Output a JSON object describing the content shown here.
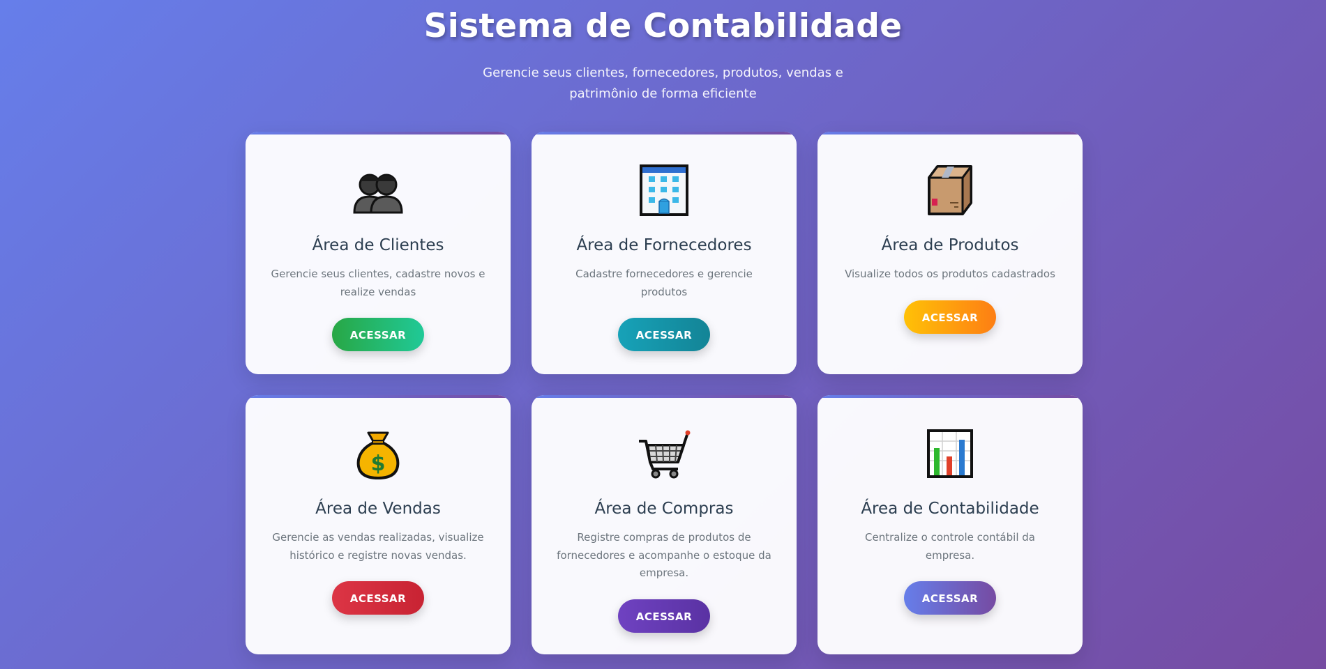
{
  "header": {
    "title": "Sistema de Contabilidade",
    "subtitle": "Gerencie seus clientes, fornecedores, produtos, vendas e patrimônio de forma eficiente"
  },
  "cards": [
    {
      "title": "Área de Clientes",
      "description": "Gerencie seus clientes, cadastre novos e realize vendas",
      "button": "ACESSAR",
      "icon": "people-icon"
    },
    {
      "title": "Área de Fornecedores",
      "description": "Cadastre fornecedores e gerencie produtos",
      "button": "ACESSAR",
      "icon": "office-building-icon"
    },
    {
      "title": "Área de Produtos",
      "description": "Visualize todos os produtos cadastrados",
      "button": "ACESSAR",
      "icon": "package-box-icon"
    },
    {
      "title": "Área de Vendas",
      "description": "Gerencie as vendas realizadas, visualize histórico e registre novas vendas.",
      "button": "ACESSAR",
      "icon": "money-bag-icon"
    },
    {
      "title": "Área de Compras",
      "description": "Registre compras de produtos de fornecedores e acompanhe o estoque da empresa.",
      "button": "ACESSAR",
      "icon": "shopping-cart-icon"
    },
    {
      "title": "Área de Contabilidade",
      "description": "Centralize o controle contábil da empresa.",
      "button": "ACESSAR",
      "icon": "bar-chart-icon"
    }
  ],
  "colors": {
    "background_start": "#667eea",
    "background_end": "#764ba2",
    "title_text": "#2c3e50",
    "description_text": "#6c757d",
    "button_clientes": "#28a745",
    "button_fornecedores": "#17a2b8",
    "button_produtos": "#fd7e14",
    "button_vendas": "#dc3545",
    "button_compras": "#6f42c1",
    "button_contabilidade": "#667eea"
  }
}
